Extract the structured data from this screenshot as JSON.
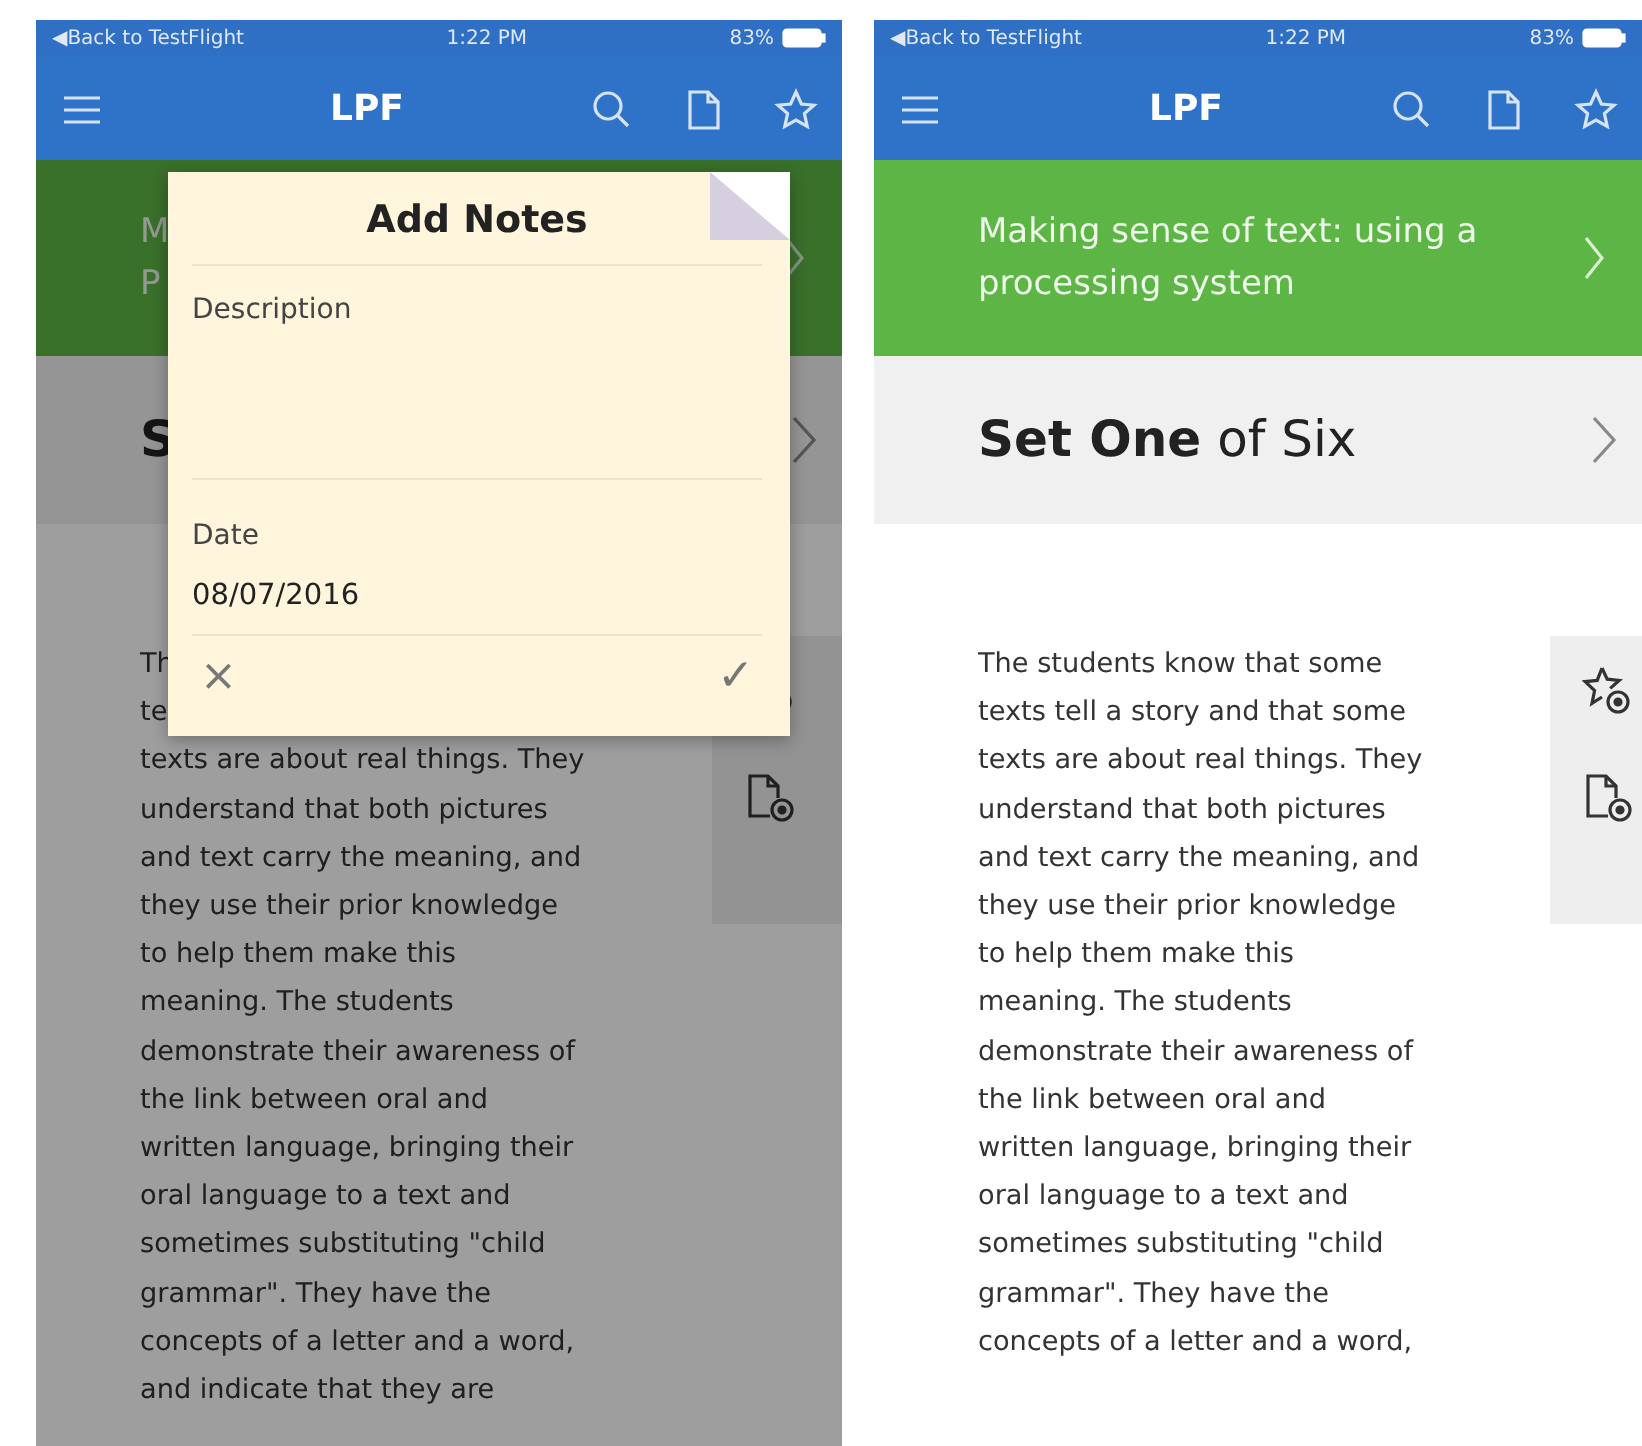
{
  "phones": [
    {
      "status": {
        "back": "◀Back to TestFlight",
        "time": "1:22 PM",
        "battery": "83%"
      },
      "nav": {
        "title": "LPF"
      },
      "dimmed": true,
      "banner_lines": [
        "M",
        "P"
      ],
      "set_title": "**S**",
      "covered_lines": [
        "Th",
        "te"
      ],
      "paragraph_lines": [
        "texts are about real things. They",
        "understand that both pictures",
        "and text carry the meaning, and",
        "they use their prior knowledge",
        "to help them make this",
        "meaning. The students",
        "demonstrate their awareness of",
        "the link between oral and",
        "written language, bringing their",
        "oral language to a text and",
        "sometimes substituting \"child",
        "grammar\". They have the",
        "concepts of a letter and a word,",
        "and indicate that they are"
      ],
      "popup": {
        "title": "Add Notes",
        "fields": [
          {
            "kind": "multiline",
            "label": "Description"
          },
          {
            "kind": "single",
            "label": "Date",
            "value": "08/07/2016"
          }
        ],
        "cancel": "×",
        "confirm": "✓"
      }
    },
    {
      "status": {
        "back": "◀Back to TestFlight",
        "time": "1:22 PM",
        "battery": "83%"
      },
      "nav": {
        "title": "LPF"
      },
      "dimmed": false,
      "banner_lines": [
        "Making sense of text: using a",
        "processing system"
      ],
      "set_title": "**Set One** of Six",
      "paragraph_lines": [
        "The students know that some",
        "texts tell a story and that some",
        "texts are about real things. They",
        "understand that both pictures",
        "and text carry the meaning, and",
        "they use their prior knowledge",
        "to help them make this",
        "meaning. The students",
        "demonstrate their awareness of",
        "the link between oral and",
        "written language, bringing their",
        "oral language to a text and",
        "sometimes substituting \"child",
        "grammar\". They have the",
        "concepts of a letter and a word,"
      ]
    }
  ]
}
